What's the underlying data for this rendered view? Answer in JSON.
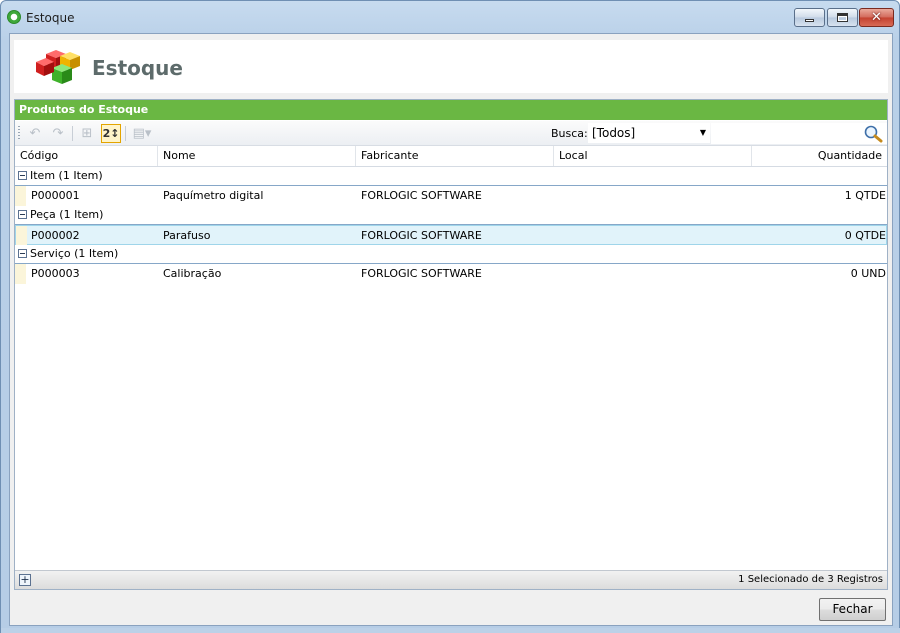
{
  "window": {
    "title": "Estoque"
  },
  "header": {
    "title": "Estoque"
  },
  "panel": {
    "title": "Produtos do Estoque"
  },
  "toolbar": {
    "busca_label": "Busca:",
    "busca_value": "[Todos]",
    "sort_label": "2↕"
  },
  "grid": {
    "columns": [
      "Código",
      "Nome",
      "Fabricante",
      "Local",
      "Quantidade"
    ],
    "groups": [
      {
        "label": "Item (1 Item)",
        "rows": [
          {
            "codigo": "P000001",
            "nome": "Paquímetro digital",
            "fabricante": "FORLOGIC SOFTWARE",
            "local": "",
            "quantidade": "1 QTDE"
          }
        ]
      },
      {
        "label": "Peça (1 Item)",
        "rows": [
          {
            "codigo": "P000002",
            "nome": "Parafuso",
            "fabricante": "FORLOGIC SOFTWARE",
            "local": "",
            "quantidade": "0 QTDE"
          }
        ]
      },
      {
        "label": "Serviço (1 Item)",
        "rows": [
          {
            "codigo": "P000003",
            "nome": "Calibração",
            "fabricante": "FORLOGIC SOFTWARE",
            "local": "",
            "quantidade": "0 UND"
          }
        ]
      }
    ]
  },
  "status": {
    "text": "1 Selecionado de 3 Registros"
  },
  "buttons": {
    "fechar": "Fechar"
  },
  "colors": {
    "panel_header": "#6ab743",
    "selected_row": "#e1f3fa"
  }
}
